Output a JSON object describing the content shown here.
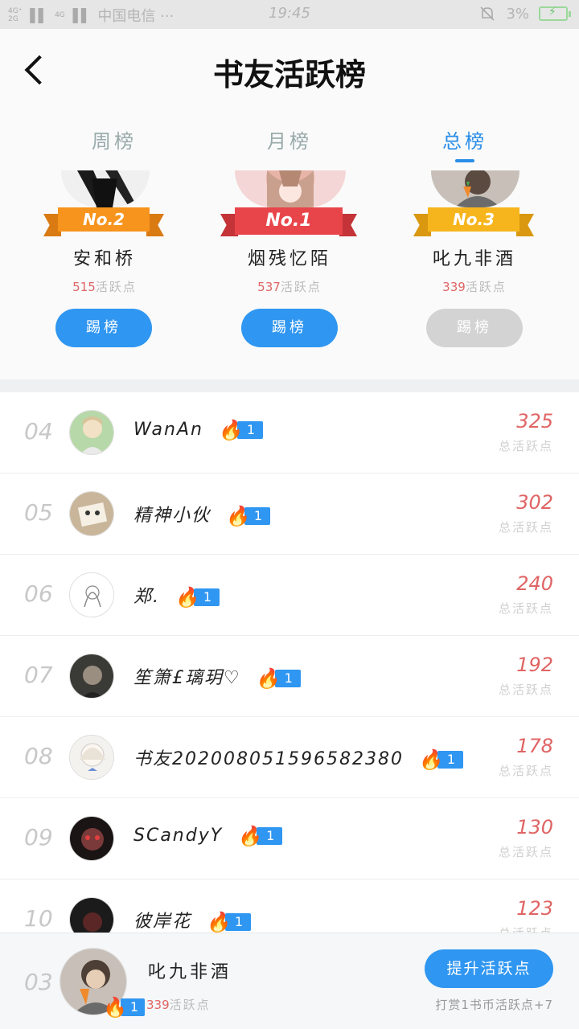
{
  "status_bar": {
    "signal_1": "4G⁺",
    "signal_2": "2G",
    "signal_3": "4G",
    "carrier": "中国电信 ···",
    "time": "19:45",
    "battery": "3%",
    "icons": [
      "signal-icon",
      "silent-bell-icon",
      "battery-icon"
    ]
  },
  "header": {
    "title": "书友活跃榜"
  },
  "tabs": [
    {
      "label": "周榜",
      "active": false
    },
    {
      "label": "月榜",
      "active": false
    },
    {
      "label": "总榜",
      "active": true
    }
  ],
  "podium": [
    {
      "badge": "No.2",
      "name": "安和桥",
      "points": "515",
      "points_label": "活跃点",
      "button": "踢榜",
      "button_enabled": true,
      "ribbon_color": "#f7941d"
    },
    {
      "badge": "No.1",
      "name": "烟残忆陌",
      "points": "537",
      "points_label": "活跃点",
      "button": "踢榜",
      "button_enabled": true,
      "ribbon_color": "#e8454a"
    },
    {
      "badge": "No.3",
      "name": "叱九非酒",
      "points": "339",
      "points_label": "活跃点",
      "button": "踢榜",
      "button_enabled": false,
      "ribbon_color": "#f7b51d"
    }
  ],
  "list": [
    {
      "rank": "04",
      "name": "WanAn",
      "level": "1",
      "score": "325",
      "score_label": "总活跃点"
    },
    {
      "rank": "05",
      "name": "精神小伙",
      "level": "1",
      "score": "302",
      "score_label": "总活跃点"
    },
    {
      "rank": "06",
      "name": "郑.",
      "level": "1",
      "score": "240",
      "score_label": "总活跃点"
    },
    {
      "rank": "07",
      "name": "笙箫£璃玥♡",
      "level": "1",
      "score": "192",
      "score_label": "总活跃点"
    },
    {
      "rank": "08",
      "name": "书友202008051596582380",
      "level": "1",
      "score": "178",
      "score_label": "总活跃点"
    },
    {
      "rank": "09",
      "name": "SCandyY",
      "level": "1",
      "score": "130",
      "score_label": "总活跃点"
    },
    {
      "rank": "10",
      "name": "彼岸花",
      "level": "1",
      "score": "123",
      "score_label": "总活跃点"
    }
  ],
  "me": {
    "rank": "03",
    "name": "叱九非酒",
    "level": "1",
    "points": "339",
    "points_label": "活跃点",
    "button": "提升活跃点",
    "hint": "打赏1书币活跃点+7"
  },
  "colors": {
    "accent": "#2f96f1",
    "score": "#e06464",
    "disabled": "#d3d3d3"
  }
}
